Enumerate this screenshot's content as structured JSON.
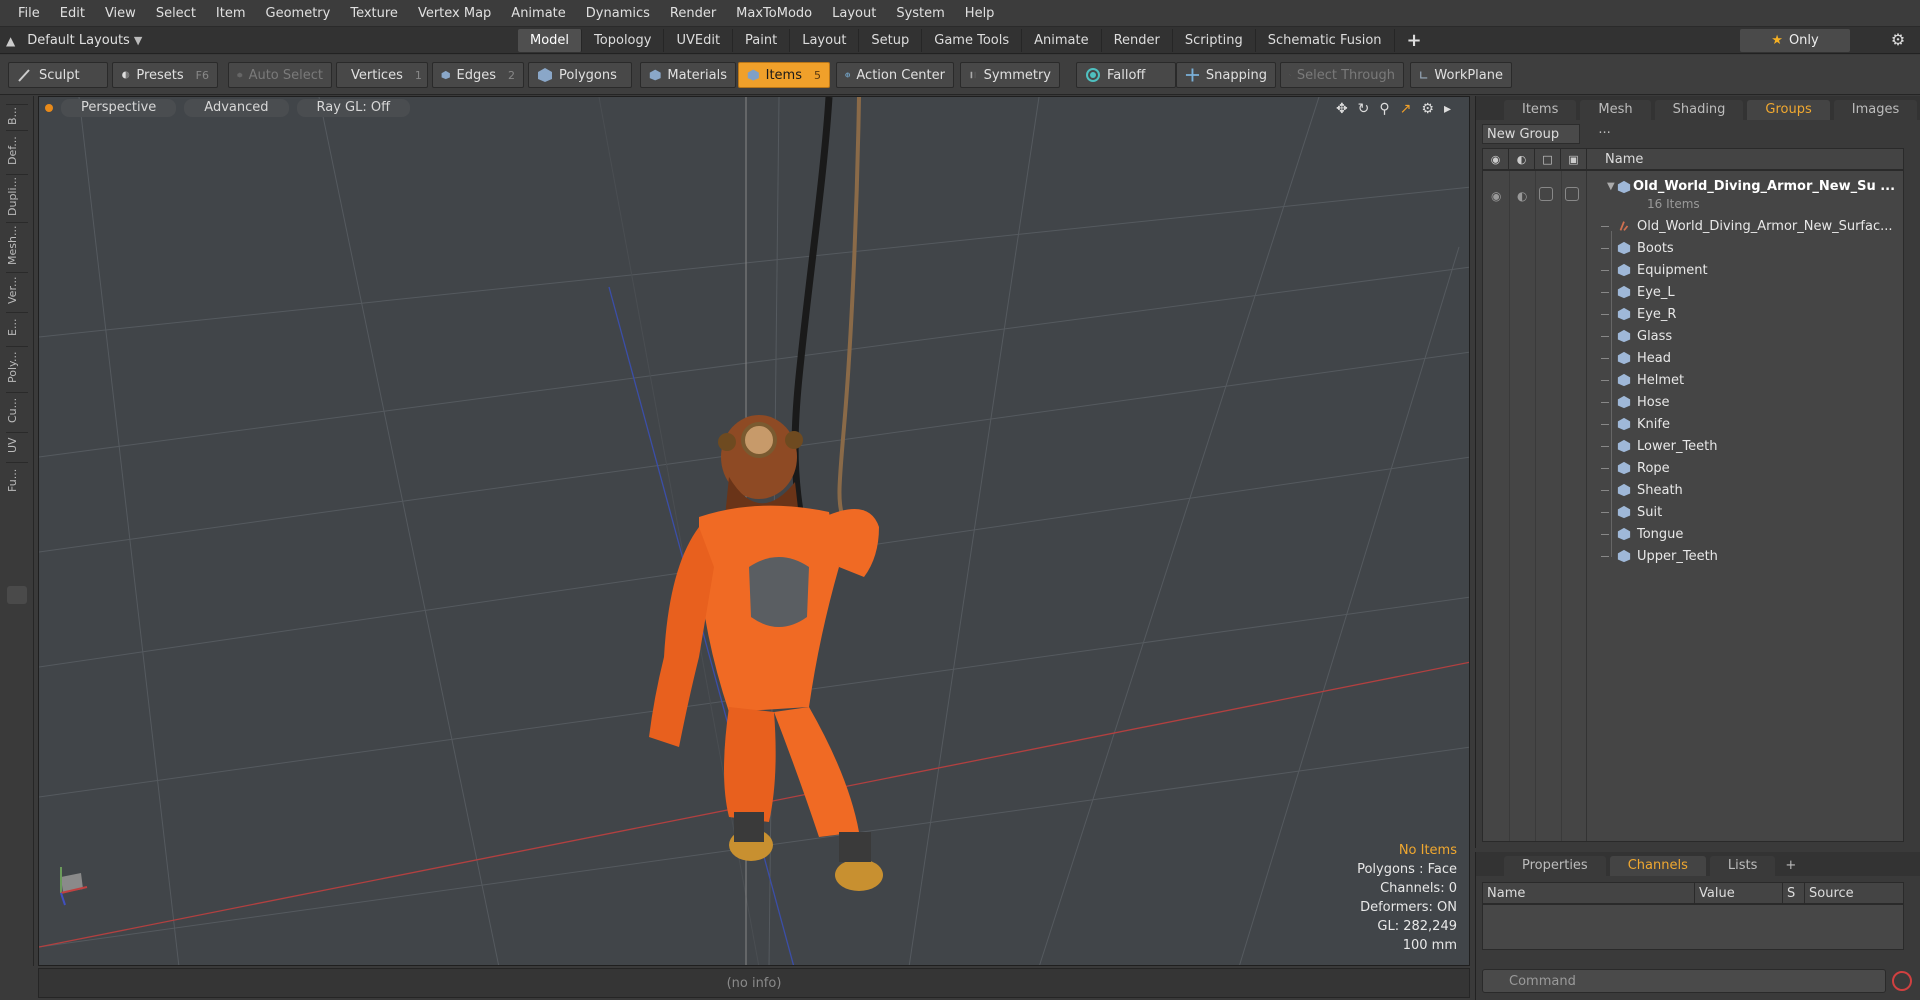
{
  "menu": [
    "File",
    "Edit",
    "View",
    "Select",
    "Item",
    "Geometry",
    "Texture",
    "Vertex Map",
    "Animate",
    "Dynamics",
    "Render",
    "MaxToModo",
    "Layout",
    "System",
    "Help"
  ],
  "layout_selector": {
    "label": "Default Layouts"
  },
  "mode_tabs": [
    {
      "label": "Model",
      "active": true
    },
    {
      "label": "Topology"
    },
    {
      "label": "UVEdit"
    },
    {
      "label": "Paint"
    },
    {
      "label": "Layout"
    },
    {
      "label": "Setup"
    },
    {
      "label": "Game Tools"
    },
    {
      "label": "Animate"
    },
    {
      "label": "Render"
    },
    {
      "label": "Scripting"
    },
    {
      "label": "Schematic Fusion"
    },
    {
      "label": "+"
    }
  ],
  "only_button": "Only",
  "toolbar": {
    "sculpt": "Sculpt",
    "presets": "Presets",
    "presets_key": "F6",
    "auto_select": "Auto Select",
    "vertices": "Vertices",
    "vertices_key": "1",
    "edges": "Edges",
    "edges_key": "2",
    "polygons": "Polygons",
    "materials": "Materials",
    "items": "Items",
    "items_key": "5",
    "action_center": "Action Center",
    "symmetry": "Symmetry",
    "falloff": "Falloff",
    "snapping": "Snapping",
    "select_through": "Select Through",
    "workplane": "WorkPlane"
  },
  "left_tabs": [
    "B...",
    "Def...",
    "Dupli...",
    "Mesh...",
    "Ver...",
    "E...",
    "Poly...",
    "Cu...",
    "UV",
    "Fu..."
  ],
  "viewport": {
    "view_mode": "Perspective",
    "advanced": "Advanced",
    "raygl": "Ray GL: Off",
    "stats": {
      "no_items": "No Items",
      "polygons": "Polygons : Face",
      "channels": "Channels: 0",
      "deformers": "Deformers: ON",
      "gl": "GL: 282,249",
      "scale": "100 mm"
    }
  },
  "status_bar": "(no info)",
  "right_panel": {
    "tabs": [
      {
        "label": "Items"
      },
      {
        "label": "Mesh ..."
      },
      {
        "label": "Shading"
      },
      {
        "label": "Groups",
        "active": true
      },
      {
        "label": "Images"
      },
      {
        "label": "+"
      }
    ],
    "new_group": "New Group",
    "column_name": "Name",
    "root": {
      "name": "Old_World_Diving_Armor_New_Su ...",
      "count": "16 Items"
    },
    "items": [
      "Old_World_Diving_Armor_New_Surfac...",
      "Boots",
      "Equipment",
      "Eye_L",
      "Eye_R",
      "Glass",
      "Head",
      "Helmet",
      "Hose",
      "Knife",
      "Lower_Teeth",
      "Rope",
      "Sheath",
      "Suit",
      "Tongue",
      "Upper_Teeth"
    ]
  },
  "bottom_panel": {
    "tabs": [
      {
        "label": "Properties"
      },
      {
        "label": "Channels",
        "active": true
      },
      {
        "label": "Lists"
      },
      {
        "label": "+"
      }
    ],
    "columns": [
      "Name",
      "Value",
      "S",
      "Source"
    ],
    "command_placeholder": "Command"
  },
  "colors": {
    "accent": "#f0a02a",
    "viewport_bg": "#414549",
    "suit": "#f06a24"
  }
}
